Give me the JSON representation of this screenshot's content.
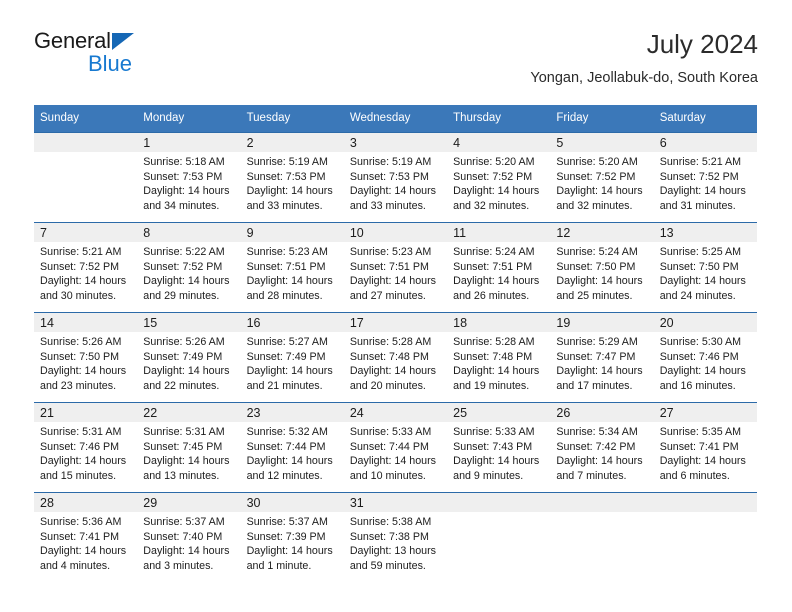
{
  "brand": {
    "name_part1": "General",
    "name_part2": "Blue",
    "triangle_color": "#1567b5",
    "blue_color": "#1779d0"
  },
  "header": {
    "title": "July 2024",
    "subtitle": "Yongan, Jeollabuk-do, South Korea"
  },
  "theme": {
    "header_bg": "#3b78b9",
    "header_text": "#ffffff",
    "row_divider": "#2c6aa8",
    "daynum_band_bg": "#efefef"
  },
  "calendar": {
    "weekday_headers": [
      "Sunday",
      "Monday",
      "Tuesday",
      "Wednesday",
      "Thursday",
      "Friday",
      "Saturday"
    ],
    "weeks": [
      [
        {
          "day": "",
          "lines": []
        },
        {
          "day": "1",
          "lines": [
            "Sunrise: 5:18 AM",
            "Sunset: 7:53 PM",
            "Daylight: 14 hours",
            "and 34 minutes."
          ]
        },
        {
          "day": "2",
          "lines": [
            "Sunrise: 5:19 AM",
            "Sunset: 7:53 PM",
            "Daylight: 14 hours",
            "and 33 minutes."
          ]
        },
        {
          "day": "3",
          "lines": [
            "Sunrise: 5:19 AM",
            "Sunset: 7:53 PM",
            "Daylight: 14 hours",
            "and 33 minutes."
          ]
        },
        {
          "day": "4",
          "lines": [
            "Sunrise: 5:20 AM",
            "Sunset: 7:52 PM",
            "Daylight: 14 hours",
            "and 32 minutes."
          ]
        },
        {
          "day": "5",
          "lines": [
            "Sunrise: 5:20 AM",
            "Sunset: 7:52 PM",
            "Daylight: 14 hours",
            "and 32 minutes."
          ]
        },
        {
          "day": "6",
          "lines": [
            "Sunrise: 5:21 AM",
            "Sunset: 7:52 PM",
            "Daylight: 14 hours",
            "and 31 minutes."
          ]
        }
      ],
      [
        {
          "day": "7",
          "lines": [
            "Sunrise: 5:21 AM",
            "Sunset: 7:52 PM",
            "Daylight: 14 hours",
            "and 30 minutes."
          ]
        },
        {
          "day": "8",
          "lines": [
            "Sunrise: 5:22 AM",
            "Sunset: 7:52 PM",
            "Daylight: 14 hours",
            "and 29 minutes."
          ]
        },
        {
          "day": "9",
          "lines": [
            "Sunrise: 5:23 AM",
            "Sunset: 7:51 PM",
            "Daylight: 14 hours",
            "and 28 minutes."
          ]
        },
        {
          "day": "10",
          "lines": [
            "Sunrise: 5:23 AM",
            "Sunset: 7:51 PM",
            "Daylight: 14 hours",
            "and 27 minutes."
          ]
        },
        {
          "day": "11",
          "lines": [
            "Sunrise: 5:24 AM",
            "Sunset: 7:51 PM",
            "Daylight: 14 hours",
            "and 26 minutes."
          ]
        },
        {
          "day": "12",
          "lines": [
            "Sunrise: 5:24 AM",
            "Sunset: 7:50 PM",
            "Daylight: 14 hours",
            "and 25 minutes."
          ]
        },
        {
          "day": "13",
          "lines": [
            "Sunrise: 5:25 AM",
            "Sunset: 7:50 PM",
            "Daylight: 14 hours",
            "and 24 minutes."
          ]
        }
      ],
      [
        {
          "day": "14",
          "lines": [
            "Sunrise: 5:26 AM",
            "Sunset: 7:50 PM",
            "Daylight: 14 hours",
            "and 23 minutes."
          ]
        },
        {
          "day": "15",
          "lines": [
            "Sunrise: 5:26 AM",
            "Sunset: 7:49 PM",
            "Daylight: 14 hours",
            "and 22 minutes."
          ]
        },
        {
          "day": "16",
          "lines": [
            "Sunrise: 5:27 AM",
            "Sunset: 7:49 PM",
            "Daylight: 14 hours",
            "and 21 minutes."
          ]
        },
        {
          "day": "17",
          "lines": [
            "Sunrise: 5:28 AM",
            "Sunset: 7:48 PM",
            "Daylight: 14 hours",
            "and 20 minutes."
          ]
        },
        {
          "day": "18",
          "lines": [
            "Sunrise: 5:28 AM",
            "Sunset: 7:48 PM",
            "Daylight: 14 hours",
            "and 19 minutes."
          ]
        },
        {
          "day": "19",
          "lines": [
            "Sunrise: 5:29 AM",
            "Sunset: 7:47 PM",
            "Daylight: 14 hours",
            "and 17 minutes."
          ]
        },
        {
          "day": "20",
          "lines": [
            "Sunrise: 5:30 AM",
            "Sunset: 7:46 PM",
            "Daylight: 14 hours",
            "and 16 minutes."
          ]
        }
      ],
      [
        {
          "day": "21",
          "lines": [
            "Sunrise: 5:31 AM",
            "Sunset: 7:46 PM",
            "Daylight: 14 hours",
            "and 15 minutes."
          ]
        },
        {
          "day": "22",
          "lines": [
            "Sunrise: 5:31 AM",
            "Sunset: 7:45 PM",
            "Daylight: 14 hours",
            "and 13 minutes."
          ]
        },
        {
          "day": "23",
          "lines": [
            "Sunrise: 5:32 AM",
            "Sunset: 7:44 PM",
            "Daylight: 14 hours",
            "and 12 minutes."
          ]
        },
        {
          "day": "24",
          "lines": [
            "Sunrise: 5:33 AM",
            "Sunset: 7:44 PM",
            "Daylight: 14 hours",
            "and 10 minutes."
          ]
        },
        {
          "day": "25",
          "lines": [
            "Sunrise: 5:33 AM",
            "Sunset: 7:43 PM",
            "Daylight: 14 hours",
            "and 9 minutes."
          ]
        },
        {
          "day": "26",
          "lines": [
            "Sunrise: 5:34 AM",
            "Sunset: 7:42 PM",
            "Daylight: 14 hours",
            "and 7 minutes."
          ]
        },
        {
          "day": "27",
          "lines": [
            "Sunrise: 5:35 AM",
            "Sunset: 7:41 PM",
            "Daylight: 14 hours",
            "and 6 minutes."
          ]
        }
      ],
      [
        {
          "day": "28",
          "lines": [
            "Sunrise: 5:36 AM",
            "Sunset: 7:41 PM",
            "Daylight: 14 hours",
            "and 4 minutes."
          ]
        },
        {
          "day": "29",
          "lines": [
            "Sunrise: 5:37 AM",
            "Sunset: 7:40 PM",
            "Daylight: 14 hours",
            "and 3 minutes."
          ]
        },
        {
          "day": "30",
          "lines": [
            "Sunrise: 5:37 AM",
            "Sunset: 7:39 PM",
            "Daylight: 14 hours",
            "and 1 minute."
          ]
        },
        {
          "day": "31",
          "lines": [
            "Sunrise: 5:38 AM",
            "Sunset: 7:38 PM",
            "Daylight: 13 hours",
            "and 59 minutes."
          ]
        },
        {
          "day": "",
          "lines": []
        },
        {
          "day": "",
          "lines": []
        },
        {
          "day": "",
          "lines": []
        }
      ]
    ]
  }
}
